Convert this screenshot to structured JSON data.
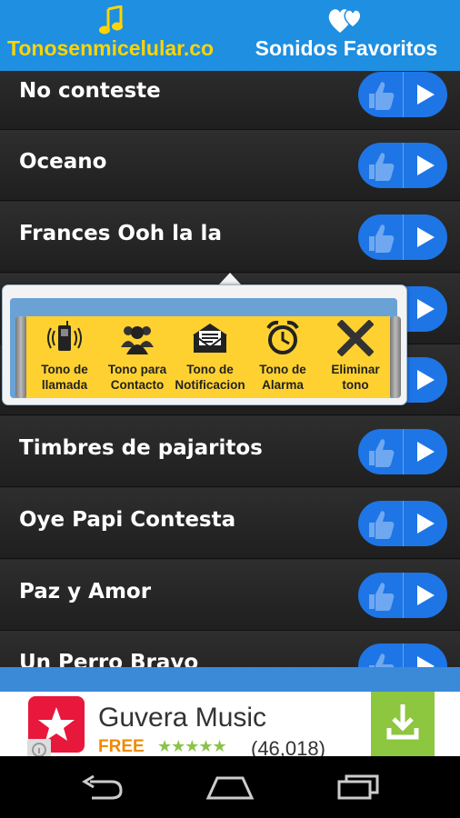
{
  "header": {
    "left_tab": {
      "label": "Tonosenmicelular.co",
      "icon": "music-note-icon"
    },
    "right_tab": {
      "label": "Sonidos Favoritos",
      "icon": "hearts-icon"
    }
  },
  "list": {
    "rows": [
      {
        "title": "No conteste"
      },
      {
        "title": "Oceano"
      },
      {
        "title": "Frances Ooh la la"
      },
      {
        "title": ""
      },
      {
        "title": ""
      },
      {
        "title": "Timbres de pajaritos"
      },
      {
        "title": "Oye Papi Contesta"
      },
      {
        "title": "Paz y Amor"
      },
      {
        "title": "Un Perro Bravo"
      }
    ]
  },
  "popup": {
    "actions": [
      {
        "label": "Tono de llamada",
        "icon": "phone-ringing-icon"
      },
      {
        "label": "Tono para Contacto",
        "icon": "contacts-group-icon"
      },
      {
        "label": "Tono de Notificacion",
        "icon": "mail-icon"
      },
      {
        "label": "Tono de Alarma",
        "icon": "alarm-clock-icon"
      },
      {
        "label": "Eliminar tono",
        "icon": "delete-x-icon"
      }
    ]
  },
  "ad": {
    "app_name": "Guvera Music",
    "price": "FREE",
    "stars": "★★★★★",
    "rating_count": "(46,018)"
  },
  "colors": {
    "header_bg": "#1E8FE1",
    "brand_yellow": "#FFD400",
    "button_blue": "#1E75E6",
    "popup_yellow": "#FFD130",
    "ad_green": "#8DC63F"
  }
}
